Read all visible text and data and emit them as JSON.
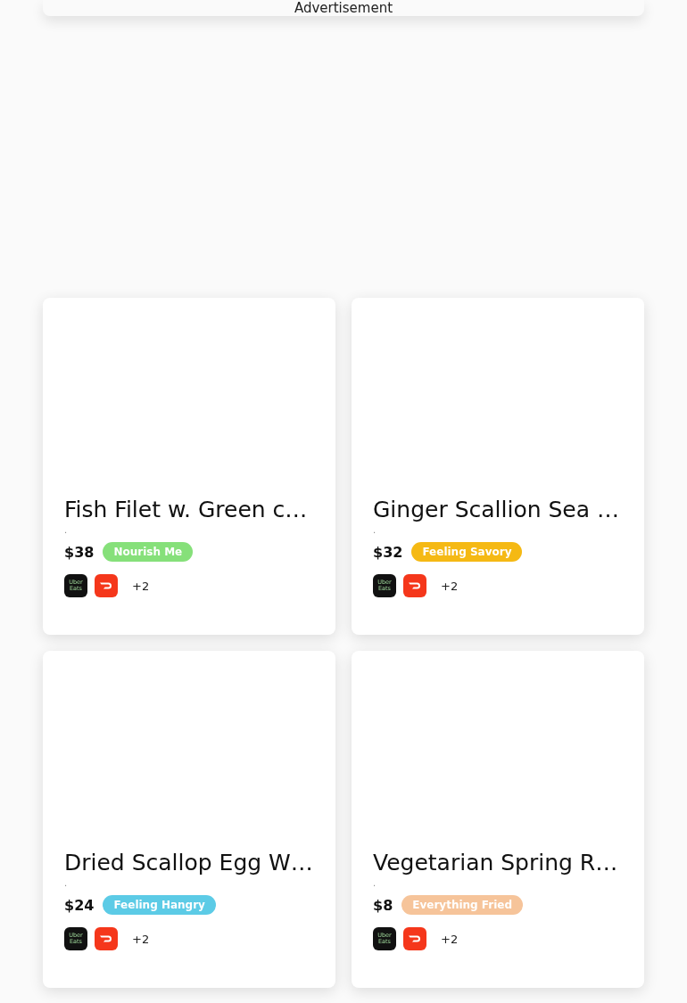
{
  "advertisement": {
    "label": "Advertisement"
  },
  "dishes": [
    {
      "title": "Fish Filet w. Green c…",
      "note": ".",
      "price": "$38",
      "tag": {
        "label": "Nourish Me",
        "color": "#86e07a"
      },
      "apps": [
        {
          "kind": "ubereats",
          "lines": [
            "Uber",
            "Eats"
          ]
        },
        {
          "kind": "doordash"
        }
      ],
      "more": "+2"
    },
    {
      "title": "Ginger Scallion Sea …",
      "note": ".",
      "price": "$32",
      "tag": {
        "label": "Feeling Savory",
        "color": "#f5b914"
      },
      "apps": [
        {
          "kind": "ubereats",
          "lines": [
            "Uber",
            "Eats"
          ]
        },
        {
          "kind": "doordash"
        }
      ],
      "more": "+2"
    },
    {
      "title": "Dried Scallop Egg W…",
      "note": ".",
      "price": "$24",
      "tag": {
        "label": "Feeling Hangry",
        "color": "#5ccbe6"
      },
      "apps": [
        {
          "kind": "ubereats",
          "lines": [
            "Uber",
            "Eats"
          ]
        },
        {
          "kind": "doordash"
        }
      ],
      "more": "+2"
    },
    {
      "title": "Vegetarian Spring R…",
      "note": ".",
      "price": "$8",
      "tag": {
        "label": "Everything Fried",
        "color": "#f6c49a"
      },
      "apps": [
        {
          "kind": "ubereats",
          "lines": [
            "Uber",
            "Eats"
          ]
        },
        {
          "kind": "doordash"
        }
      ],
      "more": "+2"
    }
  ]
}
